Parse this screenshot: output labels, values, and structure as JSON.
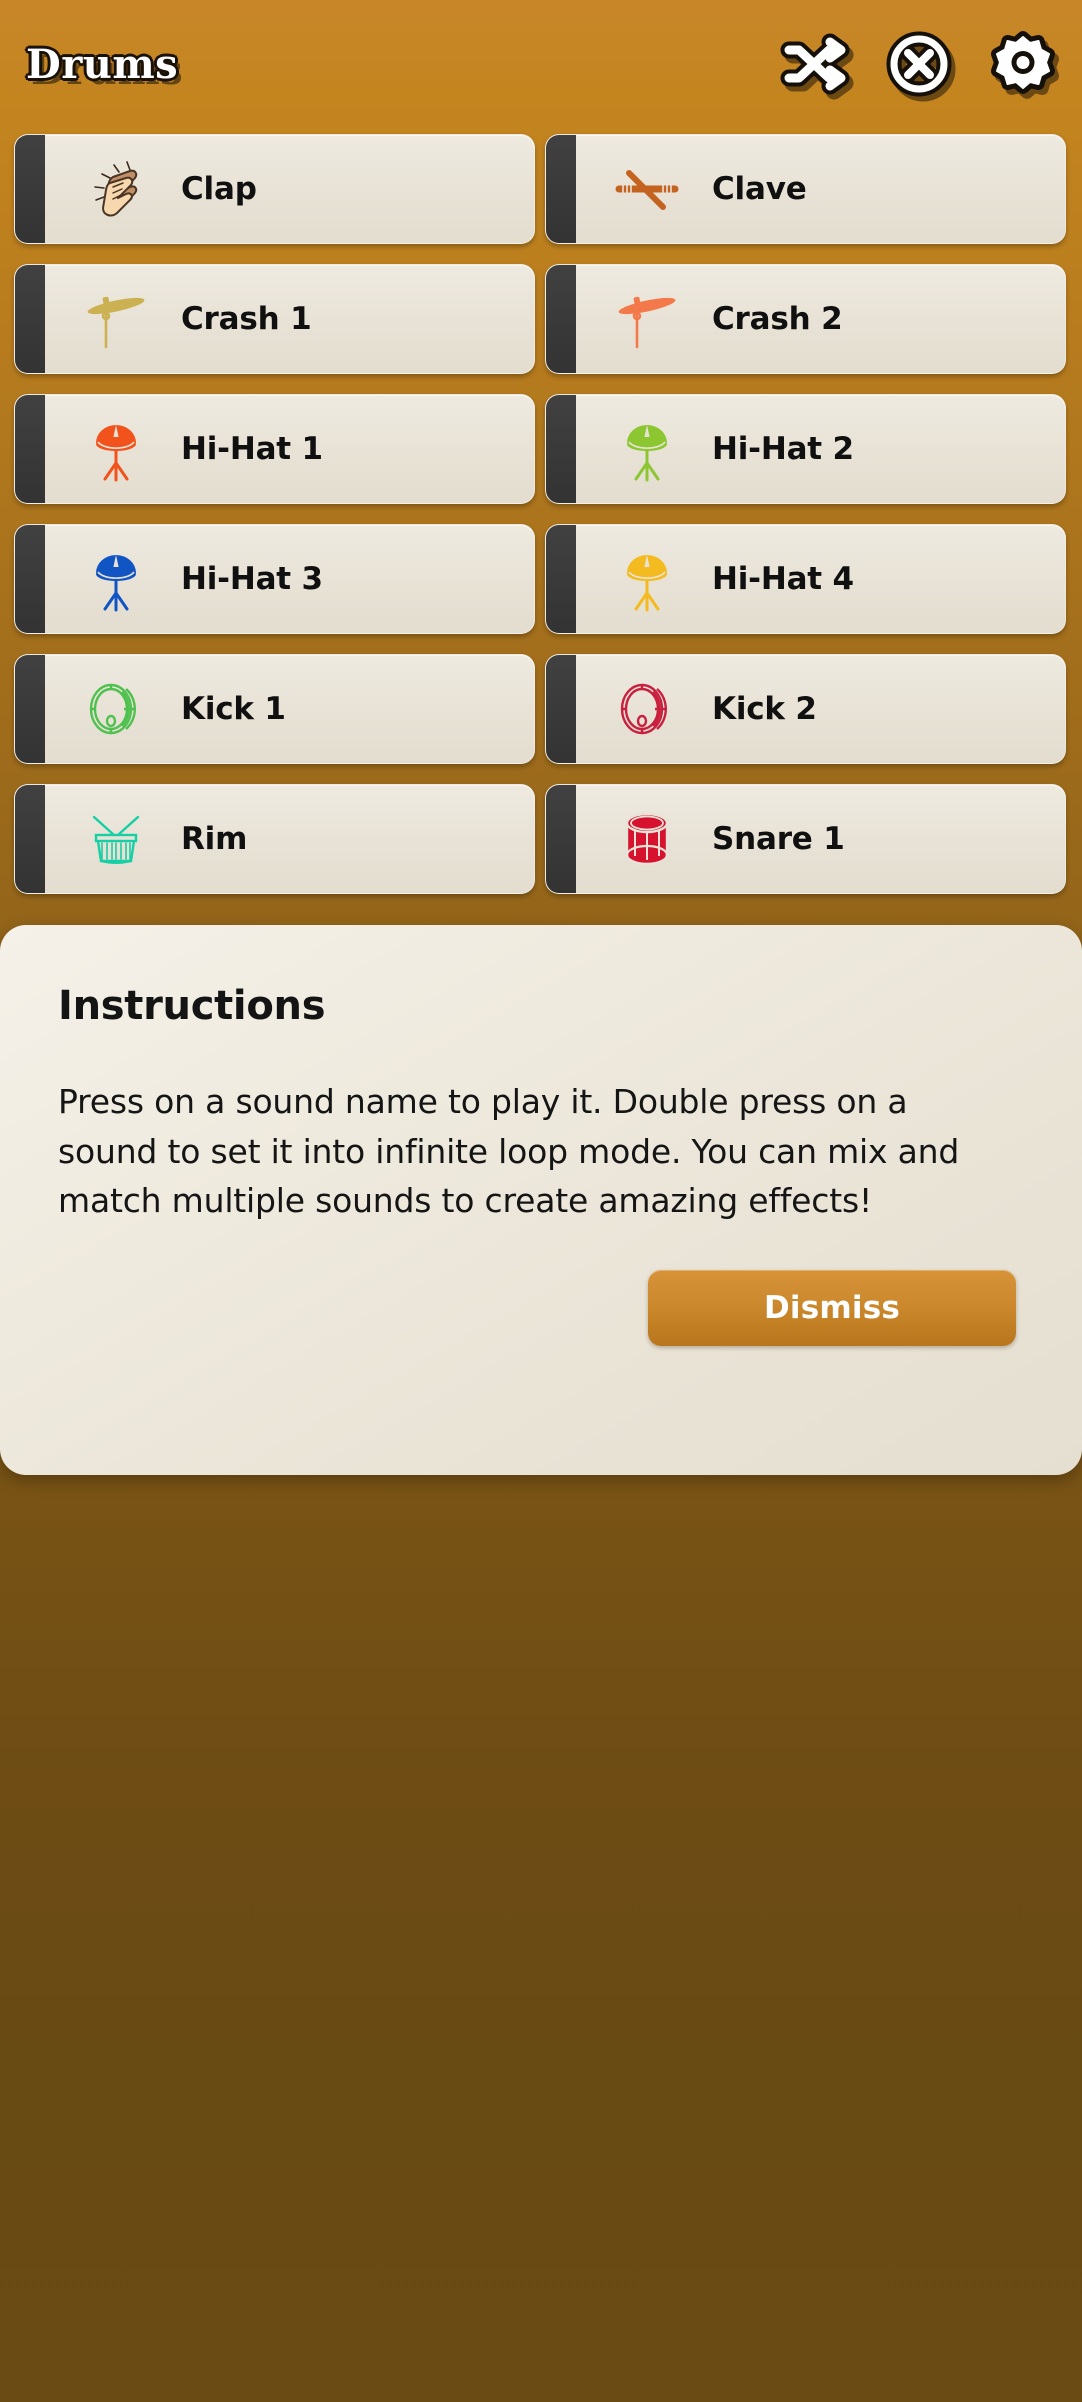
{
  "header": {
    "title": "Drums",
    "actions": [
      {
        "name": "shuffle-icon",
        "label": "Shuffle"
      },
      {
        "name": "close-icon",
        "label": "Close"
      },
      {
        "name": "settings-icon",
        "label": "Settings"
      }
    ]
  },
  "sounds": [
    {
      "label": "Clap",
      "icon": "clap-icon",
      "color": "#d6a77f"
    },
    {
      "label": "Clave",
      "icon": "clave-icon",
      "color": "#c4621f"
    },
    {
      "label": "Crash 1",
      "icon": "cymbal-icon",
      "color": "#cbb152"
    },
    {
      "label": "Crash 2",
      "icon": "cymbal-icon",
      "color": "#f4794a"
    },
    {
      "label": "Hi-Hat 1",
      "icon": "hihat-icon",
      "color": "#f2521b"
    },
    {
      "label": "Hi-Hat 2",
      "icon": "hihat-icon",
      "color": "#8cc631"
    },
    {
      "label": "Hi-Hat 3",
      "icon": "hihat-icon",
      "color": "#1154c4"
    },
    {
      "label": "Hi-Hat 4",
      "icon": "hihat-icon",
      "color": "#f3bb20"
    },
    {
      "label": "Kick 1",
      "icon": "kick-icon",
      "color": "#4fc14f"
    },
    {
      "label": "Kick 2",
      "icon": "kick-icon",
      "color": "#c9203f"
    },
    {
      "label": "Rim",
      "icon": "rim-icon",
      "color": "#17cfa4"
    },
    {
      "label": "Snare 1",
      "icon": "snare-icon",
      "color": "#d6122e"
    }
  ],
  "dialog": {
    "title": "Instructions",
    "body": "Press on a sound name to play it. Double press on a sound to set it into infinite loop mode. You can mix and match multiple sounds to create amazing effects!",
    "dismiss_label": "Dismiss"
  },
  "colors": {
    "background_top": "#c8862a",
    "background_bottom": "#6a4b13",
    "card_background": "#e9e3d7",
    "card_edge": "#3a3a3a",
    "accent": "#c9862c",
    "dialog_background": "#efeade"
  }
}
